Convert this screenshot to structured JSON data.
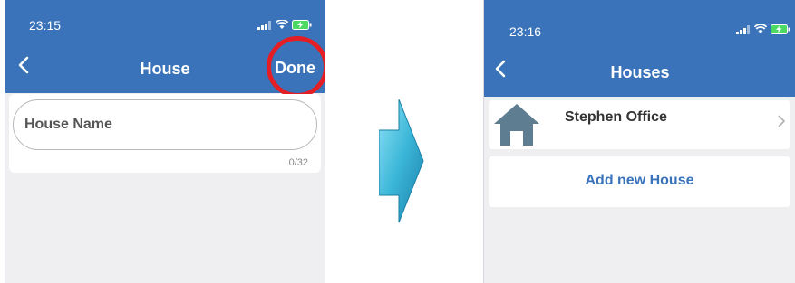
{
  "left_screen": {
    "status_time": "23:15",
    "nav": {
      "back_icon": "chevron-left-icon",
      "title": "House",
      "done_label": "Done"
    },
    "house_name": {
      "placeholder": "House Name",
      "value": "",
      "char_count": "0/32"
    }
  },
  "right_screen": {
    "status_time": "23:16",
    "nav": {
      "back_icon": "chevron-left-icon",
      "title": "Houses"
    },
    "houses": [
      {
        "name": "Stephen Office",
        "icon": "house-icon"
      }
    ],
    "add_label": "Add new House"
  },
  "colors": {
    "header": "#3a73ba",
    "background": "#efeff1",
    "highlight": "#e31e24",
    "house_icon": "#5f7d90",
    "arrow": "#3bb6d8",
    "accent_text": "#3a73ba"
  }
}
